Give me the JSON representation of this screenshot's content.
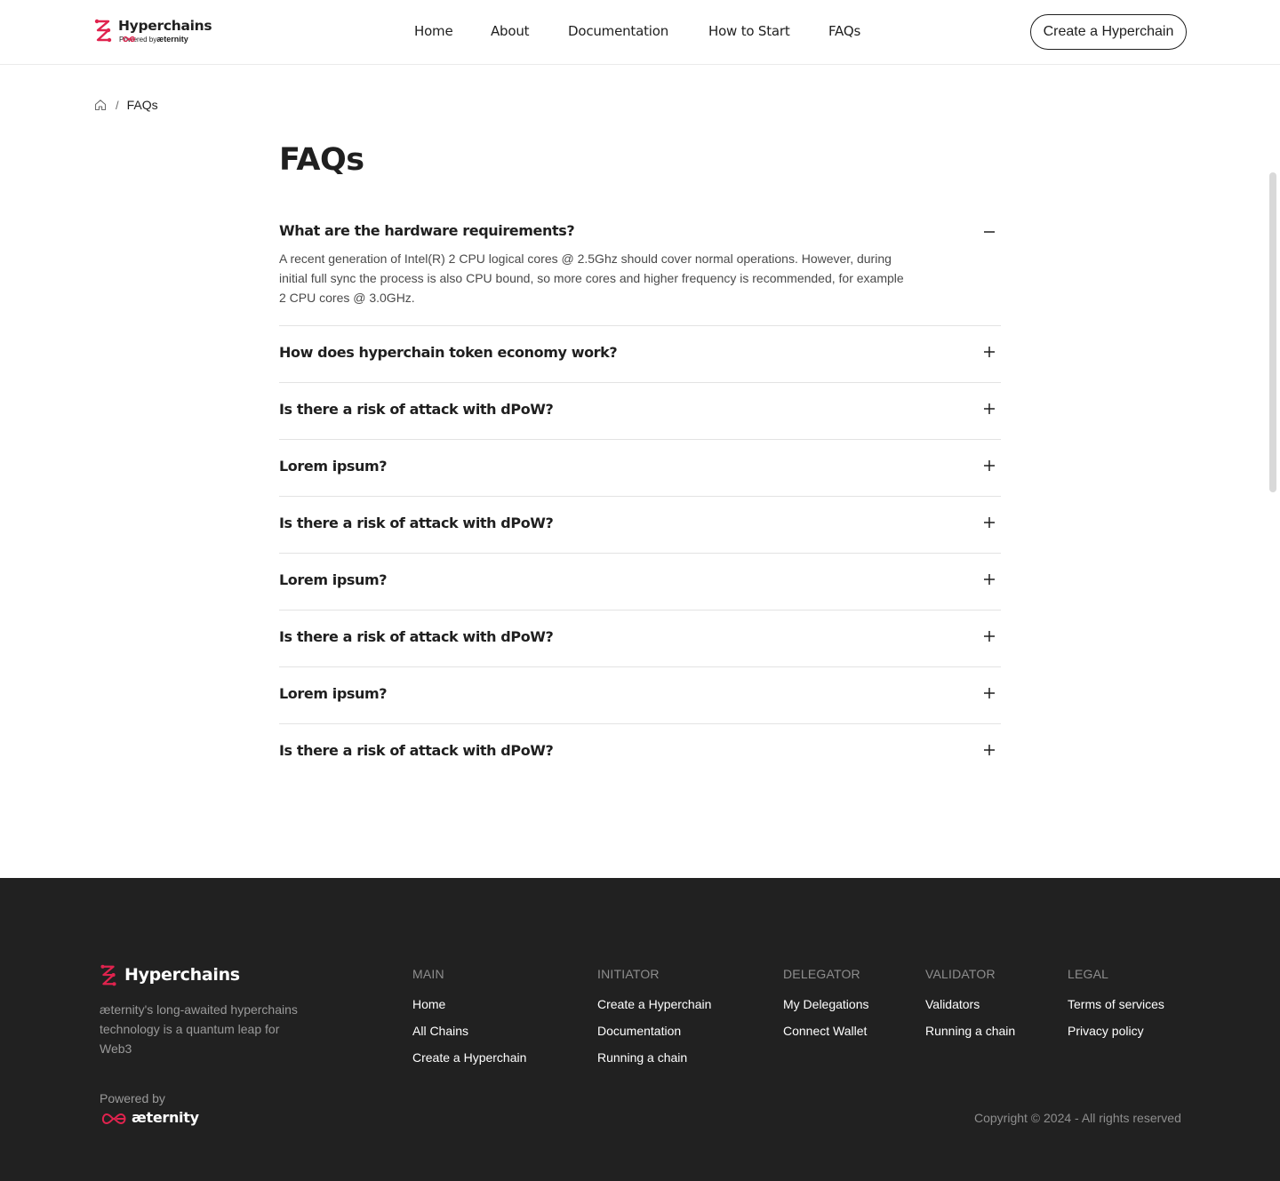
{
  "brand": {
    "name": "Hyperchains",
    "powered_by": "Powered by",
    "parent_name": "æternity",
    "accent": "#e0234e"
  },
  "nav": {
    "items": [
      {
        "label": "Home"
      },
      {
        "label": "About"
      },
      {
        "label": "Documentation"
      },
      {
        "label": "How to Start"
      },
      {
        "label": "FAQs"
      }
    ],
    "cta_label": "Create a Hyperchain"
  },
  "breadcrumb": {
    "current": "FAQs"
  },
  "page": {
    "title": "FAQs"
  },
  "faqs": [
    {
      "question": "What are the hardware requirements?",
      "answer": "A recent generation of Intel(R) 2 CPU logical cores @ 2.5Ghz should cover normal operations. However, during initial full sync the process is also CPU bound, so more cores and higher frequency is recommended, for example 2 CPU cores @ 3.0GHz.",
      "expanded": true
    },
    {
      "question": "How does hyperchain token economy work?",
      "expanded": false
    },
    {
      "question": "Is there a risk of attack with dPoW?",
      "expanded": false
    },
    {
      "question": "Lorem ipsum?",
      "expanded": false
    },
    {
      "question": "Is there a risk of attack with dPoW?",
      "expanded": false
    },
    {
      "question": "Lorem ipsum?",
      "expanded": false
    },
    {
      "question": "Is there a risk of attack with dPoW?",
      "expanded": false
    },
    {
      "question": "Lorem ipsum?",
      "expanded": false
    },
    {
      "question": "Is there a risk of attack with dPoW?",
      "expanded": false
    }
  ],
  "footer": {
    "brand_name": "Hyperchains",
    "tagline": "æternity's long-awaited hyperchains technology is a quantum leap for Web3",
    "powered_by": "Powered by",
    "parent_name": "æternity",
    "columns": [
      {
        "title": "MAIN",
        "links": [
          "Home",
          "All Chains",
          "Create a Hyperchain"
        ]
      },
      {
        "title": "INITIATOR",
        "links": [
          "Create a Hyperchain",
          "Documentation",
          "Running a chain"
        ]
      },
      {
        "title": "DELEGATOR",
        "links": [
          "My Delegations",
          "Connect Wallet"
        ]
      },
      {
        "title": "VALIDATOR",
        "links": [
          "Validators",
          "Running a chain"
        ]
      },
      {
        "title": "LEGAL",
        "links": [
          "Terms of services",
          "Privacy policy"
        ]
      }
    ],
    "copyright": "Copyright © 2024 - All rights reserved",
    "background": "#212121"
  }
}
